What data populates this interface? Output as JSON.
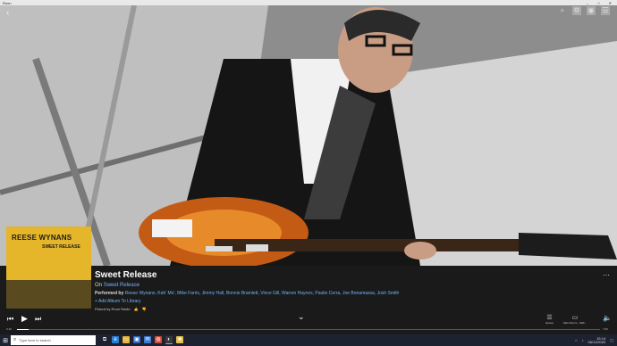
{
  "window": {
    "title": "Roon",
    "controls": [
      "–",
      "□",
      "✕"
    ]
  },
  "topbar": {
    "back_icon": "‹",
    "icons": [
      {
        "name": "search-icon",
        "glyph": "⌕"
      },
      {
        "name": "settings-icon",
        "glyph": "⚙"
      },
      {
        "name": "volume-icon",
        "glyph": "◉"
      },
      {
        "name": "user-icon",
        "glyph": "☰"
      }
    ]
  },
  "cover": {
    "artist": "REESE WYNANS",
    "album": "SWEET RELEASE"
  },
  "track": {
    "title": "Sweet Release",
    "on_prefix": "On",
    "album": "Sweet Release",
    "performed_prefix": "Performed by",
    "performers": "Reese Wynans, Keb' Mo', Mike Farris, Jimmy Hall, Bonnie Bramlett, Vince Gill, Warren Haynes, Paulie Cerra, Joe Bonamassa, Josh Smith",
    "add_library": "+ Add Album To Library",
    "picked_by": "Picked by Roon Radio",
    "more": "⋯"
  },
  "player": {
    "prev": "⏮",
    "play": "▶",
    "next": "⏭",
    "chevron": "⌄",
    "queue_label": "Queue",
    "zone_label": "Main Room - KEF...",
    "elapsed": "0:16",
    "duration": "7:06",
    "progress_fraction": 0.02,
    "volume_icon": "🔈"
  },
  "taskbar": {
    "search_placeholder": "Type here to search",
    "apps": [
      {
        "name": "task-view-icon",
        "glyph": "⧉",
        "color": "#1c2230"
      },
      {
        "name": "edge-icon",
        "glyph": "e",
        "color": "#2a7fd4"
      },
      {
        "name": "explorer-icon",
        "glyph": "▭",
        "color": "#e8b43a"
      },
      {
        "name": "store-icon",
        "glyph": "▣",
        "color": "#2a6cc4"
      },
      {
        "name": "mail-icon",
        "glyph": "✉",
        "color": "#3a7bd5"
      },
      {
        "name": "chrome-icon",
        "glyph": "◍",
        "color": "#d64a3a"
      },
      {
        "name": "roon-icon",
        "glyph": "◐",
        "color": "#3a3a3a"
      },
      {
        "name": "app-icon",
        "glyph": "■",
        "color": "#e6c14a"
      }
    ],
    "clock_time": "15:14",
    "clock_date": "06/11/2020"
  }
}
